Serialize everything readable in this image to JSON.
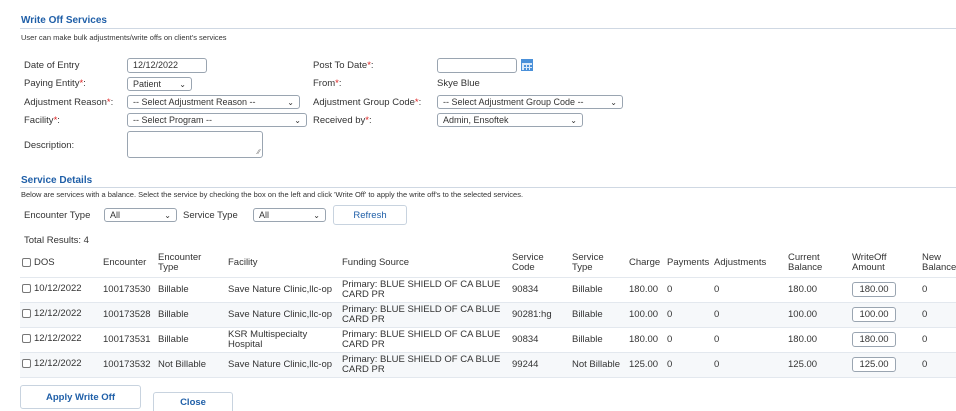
{
  "header": {
    "title": "Write Off Services",
    "description": "User can make bulk adjustments/write offs on client's services"
  },
  "form": {
    "date_of_entry_label": "Date of Entry",
    "date_of_entry_value": "12/12/2022",
    "post_to_date_label": "Post To Date",
    "post_to_date_value": "",
    "paying_entity_label": "Paying Entity",
    "paying_entity_value": "Patient",
    "from_label": "From",
    "from_value": "Skye Blue",
    "adjustment_reason_label": "Adjustment Reason",
    "adjustment_reason_value": "-- Select Adjustment Reason --",
    "adjustment_group_code_label": "Adjustment Group Code",
    "adjustment_group_code_value": "-- Select Adjustment Group Code --",
    "facility_label": "Facility",
    "facility_value": "-- Select Program --",
    "received_by_label": "Received by",
    "received_by_value": "Admin, Ensoftek",
    "description_label": "Description:",
    "description_value": "",
    "required_mark": "*",
    "colon": ":"
  },
  "service_details": {
    "title": "Service Details",
    "description": "Below are services with a balance. Select the service by checking the box on the left and click 'Write Off' to apply the write off's to the selected services.",
    "encounter_type_label": "Encounter Type",
    "encounter_type_value": "All",
    "service_type_label": "Service Type",
    "service_type_value": "All",
    "refresh_label": "Refresh",
    "total_results": "Total Results: 4"
  },
  "table": {
    "columns": [
      "DOS",
      "Encounter",
      "Encounter Type",
      "Facility",
      "Funding Source",
      "Service Code",
      "Service Type",
      "Charge",
      "Payments",
      "Adjustments",
      "Current Balance",
      "WriteOff Amount",
      "New Balance"
    ],
    "rows": [
      {
        "dos": "10/12/2022",
        "encounter": "100173530",
        "encounter_type": "Billable",
        "facility": "Save Nature Clinic,llc-op",
        "funding_source": "Primary: BLUE SHIELD OF CA BLUE CARD PR",
        "service_code": "90834",
        "service_type": "Billable",
        "charge": "180.00",
        "payments": "0",
        "adjustments": "0",
        "current_balance": "180.00",
        "writeoff_amount": "180.00",
        "new_balance": "0"
      },
      {
        "dos": "12/12/2022",
        "encounter": "100173528",
        "encounter_type": "Billable",
        "facility": "Save Nature Clinic,llc-op",
        "funding_source": "Primary: BLUE SHIELD OF CA BLUE CARD PR",
        "service_code": "90281:hg",
        "service_type": "Billable",
        "charge": "100.00",
        "payments": "0",
        "adjustments": "0",
        "current_balance": "100.00",
        "writeoff_amount": "100.00",
        "new_balance": "0"
      },
      {
        "dos": "12/12/2022",
        "encounter": "100173531",
        "encounter_type": "Billable",
        "facility": "KSR Multispecialty Hospital",
        "funding_source": "Primary: BLUE SHIELD OF CA BLUE CARD PR",
        "service_code": "90834",
        "service_type": "Billable",
        "charge": "180.00",
        "payments": "0",
        "adjustments": "0",
        "current_balance": "180.00",
        "writeoff_amount": "180.00",
        "new_balance": "0"
      },
      {
        "dos": "12/12/2022",
        "encounter": "100173532",
        "encounter_type": "Not Billable",
        "facility": "Save Nature Clinic,llc-op",
        "funding_source": "Primary: BLUE SHIELD OF CA BLUE CARD PR",
        "service_code": "99244",
        "service_type": "Not Billable",
        "charge": "125.00",
        "payments": "0",
        "adjustments": "0",
        "current_balance": "125.00",
        "writeoff_amount": "125.00",
        "new_balance": "0"
      }
    ]
  },
  "actions": {
    "apply_label": "Apply Write Off",
    "close_label": "Close"
  },
  "icons": {
    "calendar": "calendar-icon",
    "dropdown": "chevron-down-icon",
    "resize": "resize-grip-icon"
  },
  "colors": {
    "accent": "#1f5fa8",
    "required": "#dd2222"
  }
}
